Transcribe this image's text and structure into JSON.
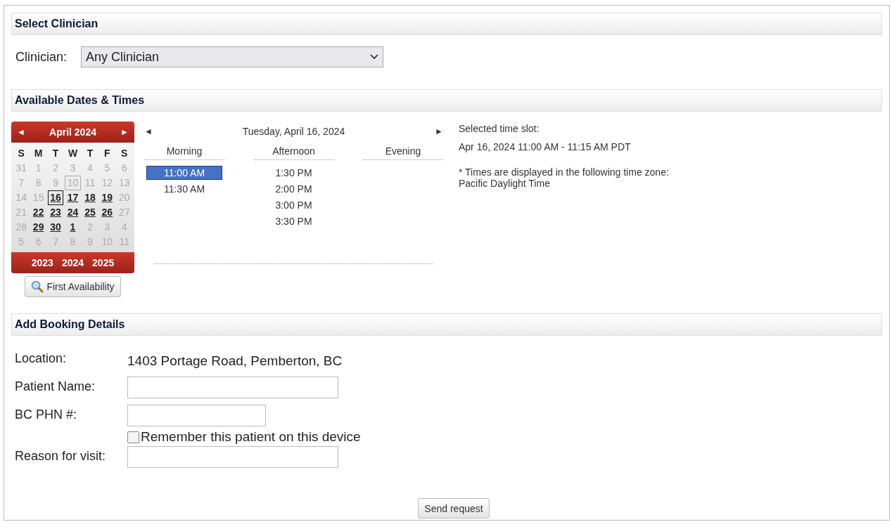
{
  "sections": [
    "Select Clinician",
    "Available Dates & Times",
    "Add Booking Details"
  ],
  "clinician": {
    "label": "Clinician:",
    "value": "Any Clinician"
  },
  "calendar": {
    "prev": "◄",
    "title": "April 2024",
    "next": "►",
    "weekdays": [
      "S",
      "M",
      "T",
      "W",
      "T",
      "F",
      "S"
    ],
    "weeks": [
      [
        {
          "d": "31",
          "available": false,
          "selected": false,
          "today": false
        },
        {
          "d": "1",
          "available": false,
          "selected": false,
          "today": false
        },
        {
          "d": "2",
          "available": false,
          "selected": false,
          "today": false
        },
        {
          "d": "3",
          "available": false,
          "selected": false,
          "today": false
        },
        {
          "d": "4",
          "available": false,
          "selected": false,
          "today": false
        },
        {
          "d": "5",
          "available": false,
          "selected": false,
          "today": false
        },
        {
          "d": "6",
          "available": false,
          "selected": false,
          "today": false
        }
      ],
      [
        {
          "d": "7",
          "available": false,
          "selected": false,
          "today": false
        },
        {
          "d": "8",
          "available": false,
          "selected": false,
          "today": false
        },
        {
          "d": "9",
          "available": false,
          "selected": false,
          "today": false
        },
        {
          "d": "10",
          "available": false,
          "selected": false,
          "today": true
        },
        {
          "d": "11",
          "available": false,
          "selected": false,
          "today": false
        },
        {
          "d": "12",
          "available": false,
          "selected": false,
          "today": false
        },
        {
          "d": "13",
          "available": false,
          "selected": false,
          "today": false
        }
      ],
      [
        {
          "d": "14",
          "available": false,
          "selected": false,
          "today": false
        },
        {
          "d": "15",
          "available": false,
          "selected": false,
          "today": false
        },
        {
          "d": "16",
          "available": true,
          "selected": true,
          "today": false
        },
        {
          "d": "17",
          "available": true,
          "selected": false,
          "today": false
        },
        {
          "d": "18",
          "available": true,
          "selected": false,
          "today": false
        },
        {
          "d": "19",
          "available": true,
          "selected": false,
          "today": false
        },
        {
          "d": "20",
          "available": false,
          "selected": false,
          "today": false
        }
      ],
      [
        {
          "d": "21",
          "available": false,
          "selected": false,
          "today": false
        },
        {
          "d": "22",
          "available": true,
          "selected": false,
          "today": false
        },
        {
          "d": "23",
          "available": true,
          "selected": false,
          "today": false
        },
        {
          "d": "24",
          "available": true,
          "selected": false,
          "today": false
        },
        {
          "d": "25",
          "available": true,
          "selected": false,
          "today": false
        },
        {
          "d": "26",
          "available": true,
          "selected": false,
          "today": false
        },
        {
          "d": "27",
          "available": false,
          "selected": false,
          "today": false
        }
      ],
      [
        {
          "d": "28",
          "available": false,
          "selected": false,
          "today": false
        },
        {
          "d": "29",
          "available": true,
          "selected": false,
          "today": false
        },
        {
          "d": "30",
          "available": true,
          "selected": false,
          "today": false
        },
        {
          "d": "1",
          "available": true,
          "selected": false,
          "today": false
        },
        {
          "d": "2",
          "available": false,
          "selected": false,
          "today": false
        },
        {
          "d": "3",
          "available": false,
          "selected": false,
          "today": false
        },
        {
          "d": "4",
          "available": false,
          "selected": false,
          "today": false
        }
      ],
      [
        {
          "d": "5",
          "available": false,
          "selected": false,
          "today": false
        },
        {
          "d": "6",
          "available": false,
          "selected": false,
          "today": false
        },
        {
          "d": "7",
          "available": false,
          "selected": false,
          "today": false
        },
        {
          "d": "8",
          "available": false,
          "selected": false,
          "today": false
        },
        {
          "d": "9",
          "available": false,
          "selected": false,
          "today": false
        },
        {
          "d": "10",
          "available": false,
          "selected": false,
          "today": false
        },
        {
          "d": "11",
          "available": false,
          "selected": false,
          "today": false
        }
      ]
    ],
    "years": [
      "2023",
      "2024",
      "2025"
    ],
    "first_availability": "First Availability"
  },
  "day_nav": {
    "prev": "◄",
    "date": "Tuesday, April 16, 2024",
    "next": "►"
  },
  "periods": [
    {
      "label": "Morning",
      "slots": [
        {
          "time": "11:00 AM",
          "selected": true
        },
        {
          "time": "11:30 AM",
          "selected": false
        }
      ]
    },
    {
      "label": "Afternoon",
      "slots": [
        {
          "time": "1:30 PM",
          "selected": false
        },
        {
          "time": "2:00 PM",
          "selected": false
        },
        {
          "time": "3:00 PM",
          "selected": false
        },
        {
          "time": "3:30 PM",
          "selected": false
        }
      ]
    },
    {
      "label": "Evening"
    }
  ],
  "selected_slot": {
    "label": "Selected time slot:",
    "value": "Apr 16, 2024 11:00 AM - 11:15 AM PDT",
    "note": "* Times are displayed in the following time zone:",
    "zone": "Pacific Daylight Time"
  },
  "details": [
    {
      "kind": "text",
      "label": "Location:",
      "value": "1403 Portage Road, Pemberton, BC"
    },
    {
      "kind": "input",
      "label": "Patient Name:"
    },
    {
      "kind": "input",
      "label": "BC PHN #:",
      "checkbox": {
        "label": "Remember this patient on this device",
        "checked": false
      }
    },
    {
      "kind": "input",
      "label": "Reason for visit:"
    }
  ],
  "submit": "Send request"
}
